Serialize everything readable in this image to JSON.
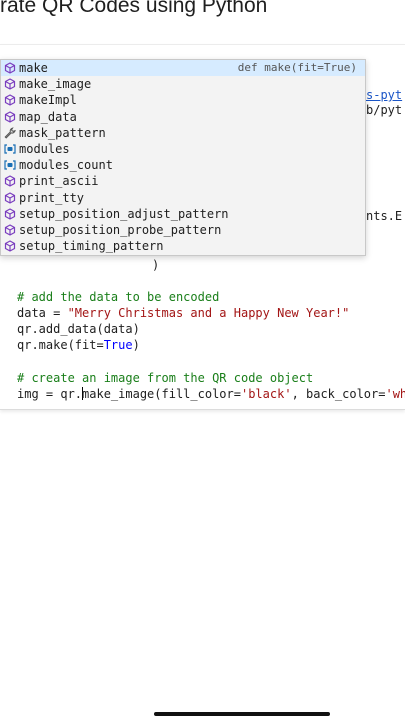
{
  "page": {
    "title": "rate QR Codes using Python"
  },
  "code": {
    "hidden_links": {
      "link1": "s-pyt",
      "link2": "b/pyt",
      "attr": "nts.E"
    },
    "paren": ")",
    "comment_add": "# add the data to be encoded",
    "line_data_prefix": "data = ",
    "line_data_string": "\"Merry Christmas and a Happy New Year!\"",
    "line_add_data": "qr.add_data(data)",
    "line_make_prefix": "qr.make(fit=",
    "line_make_kw": "True",
    "line_make_suffix": ")",
    "comment_image": "# create an image from the QR code object",
    "line_img_prefix": "img = qr.",
    "line_img_call": "make_image(fill_color=",
    "line_img_str1": "'black'",
    "line_img_mid": ", back_color=",
    "line_img_str2": "'wh"
  },
  "autocomplete": {
    "items": [
      {
        "label": "make",
        "icon": "method-icon",
        "detail": "def make(fit=True)",
        "selected": true
      },
      {
        "label": "make_image",
        "icon": "method-icon"
      },
      {
        "label": "makeImpl",
        "icon": "method-icon"
      },
      {
        "label": "map_data",
        "icon": "method-icon"
      },
      {
        "label": "mask_pattern",
        "icon": "wrench-icon"
      },
      {
        "label": "modules",
        "icon": "variable-icon"
      },
      {
        "label": "modules_count",
        "icon": "variable-icon"
      },
      {
        "label": "print_ascii",
        "icon": "method-icon"
      },
      {
        "label": "print_tty",
        "icon": "method-icon"
      },
      {
        "label": "setup_position_adjust_pattern",
        "icon": "method-icon"
      },
      {
        "label": "setup_position_probe_pattern",
        "icon": "method-icon"
      },
      {
        "label": "setup_timing_pattern",
        "icon": "method-icon"
      }
    ]
  },
  "colors": {
    "comment": "#1a7f1a",
    "string": "#a31515",
    "keyword": "#0000ff",
    "method_icon": "#7b3fbf",
    "variable_icon": "#1a6fb5"
  }
}
